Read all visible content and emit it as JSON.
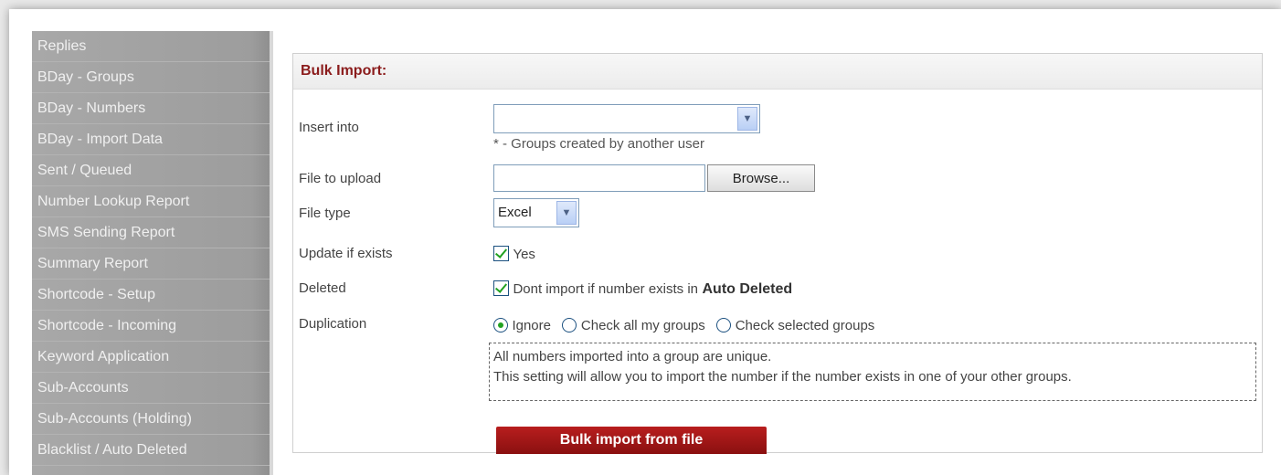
{
  "sidebar": {
    "items": [
      {
        "label": "Replies"
      },
      {
        "label": "BDay - Groups"
      },
      {
        "label": "BDay - Numbers"
      },
      {
        "label": "BDay - Import Data"
      },
      {
        "label": "Sent / Queued"
      },
      {
        "label": "Number Lookup Report"
      },
      {
        "label": "SMS Sending Report"
      },
      {
        "label": "Summary Report"
      },
      {
        "label": "Shortcode - Setup"
      },
      {
        "label": "Shortcode - Incoming"
      },
      {
        "label": "Keyword Application"
      },
      {
        "label": "Sub-Accounts"
      },
      {
        "label": "Sub-Accounts (Holding)"
      },
      {
        "label": "Blacklist / Auto Deleted"
      }
    ]
  },
  "panel": {
    "title": "Bulk Import:"
  },
  "form": {
    "insert_into_label": "Insert into",
    "insert_into_value": "",
    "insert_into_hint": "* - Groups created by another user",
    "file_label": "File to upload",
    "file_value": "",
    "browse_label": "Browse...",
    "file_type_label": "File type",
    "file_type_value": "Excel",
    "update_label": "Update if exists",
    "update_option": "Yes",
    "deleted_label": "Deleted",
    "deleted_option_prefix": "Dont import if number exists in",
    "deleted_option_bold": "Auto Deleted",
    "duplication_label": "Duplication",
    "duplication_options": [
      {
        "label": "Ignore",
        "selected": true
      },
      {
        "label": "Check all my groups",
        "selected": false
      },
      {
        "label": "Check selected groups",
        "selected": false
      }
    ],
    "note_line1": "All numbers imported into a group are unique.",
    "note_line2": "This setting will allow you to import the number if the number exists in one of your other groups.",
    "submit_label": "Bulk import from file"
  },
  "colors": {
    "sidebar_bg": "#a3a3a3",
    "header_text": "#8b1c1c",
    "submit_bg": "#a51818",
    "check_color": "#21a121"
  }
}
